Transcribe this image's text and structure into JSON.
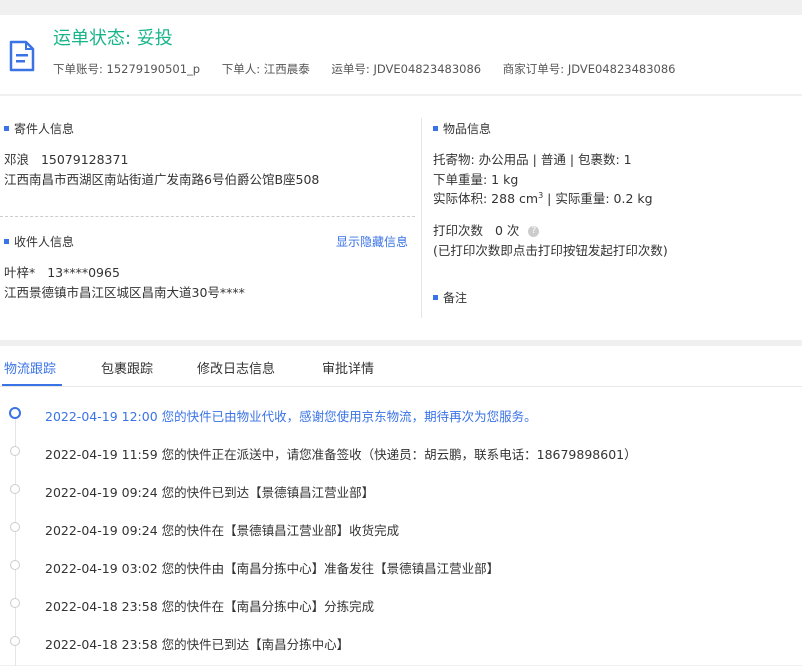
{
  "header": {
    "status_label": "运单状态:",
    "status_value": "妥投",
    "account_label": "下单账号:",
    "account_value": "15279190501_p",
    "orderer_label": "下单人:",
    "orderer_value": "江西晨泰",
    "waybill_label": "运单号:",
    "waybill_value": "JDVE04823483086",
    "merchant_label": "商家订单号:",
    "merchant_value": "JDVE04823483086",
    "icon": "document-icon",
    "accent_color": "#19b58a"
  },
  "sender": {
    "title": "寄件人信息",
    "name": "邓浪",
    "phone": "15079128371",
    "address": "江西南昌市西湖区南站街道广发南路6号伯爵公馆B座508"
  },
  "receiver": {
    "title": "收件人信息",
    "toggle_link": "显示隐藏信息",
    "name": "叶梓*",
    "phone": "13****0965",
    "address": "江西景德镇市昌江区城区昌南大道30号****"
  },
  "goods": {
    "title": "物品信息",
    "line1": "托寄物:  办公用品 | 普通  |  包裹数:  1",
    "line2": "下单重量:   1 kg",
    "line3_a": "实际体积:    288 cm",
    "line3_sup": "3",
    "line3_b": " |  实际重量:   0.2 kg",
    "print_label": "打印次数",
    "print_value": "0 次",
    "print_note": "(已打印次数即点击打印按钮发起打印次数)",
    "help_icon": "question-icon"
  },
  "remark": {
    "title": "备注"
  },
  "tabs": [
    "物流跟踪",
    "包裹跟踪",
    "修改日志信息",
    "审批详情"
  ],
  "tracking": [
    "2022-04-19 12:00  您的快件已由物业代收，感谢您使用京东物流，期待再次为您服务。",
    "2022-04-19 11:59  您的快件正在派送中，请您准备签收（快递员：胡云鹏，联系电话：18679898601）",
    "2022-04-19 09:24  您的快件已到达【景德镇昌江营业部】",
    "2022-04-19 09:24  您的快件在【景德镇昌江营业部】收货完成",
    "2022-04-19 03:02  您的快件由【南昌分拣中心】准备发往【景德镇昌江营业部】",
    "2022-04-18 23:58  您的快件在【南昌分拣中心】分拣完成",
    "2022-04-18 23:58  您的快件已到达【南昌分拣中心】"
  ],
  "colors": {
    "primary": "#3a73e6",
    "success": "#19b58a"
  }
}
